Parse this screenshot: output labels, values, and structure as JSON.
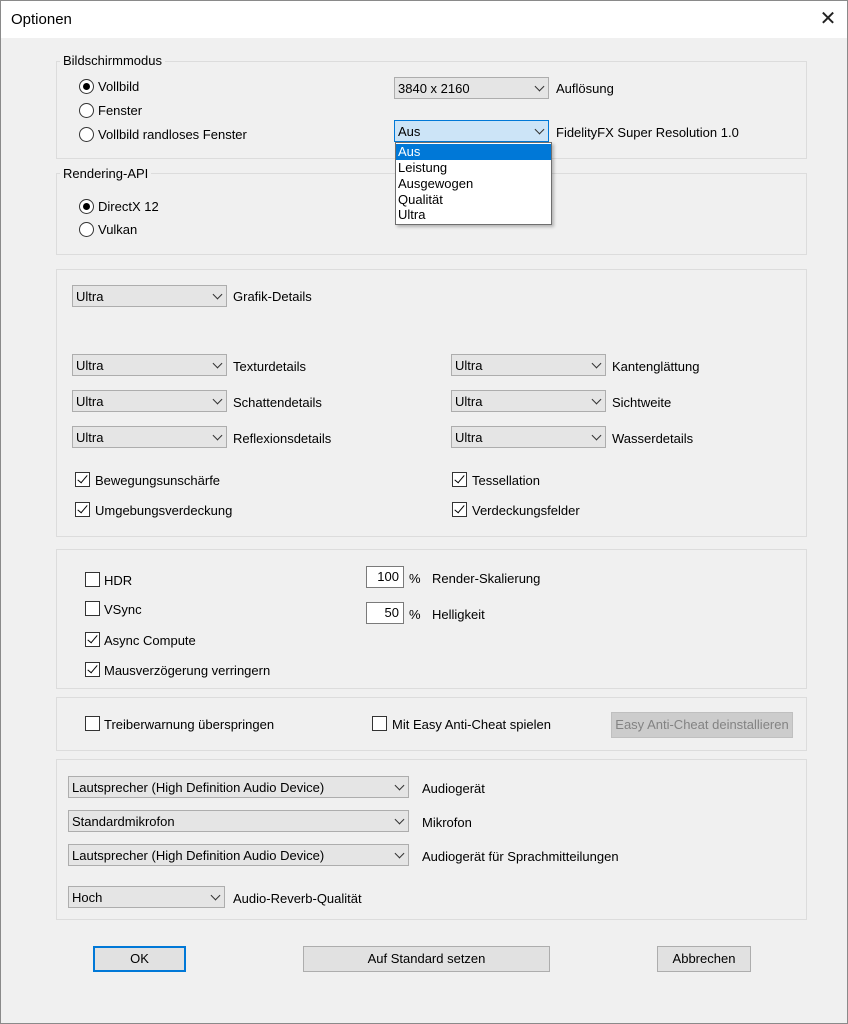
{
  "window": {
    "title": "Optionen",
    "close_glyph": "✕"
  },
  "screen_mode": {
    "group_label": "Bildschirmmodus",
    "options": [
      "Vollbild",
      "Fenster",
      "Vollbild randloses Fenster"
    ],
    "selected": "Vollbild",
    "resolution": {
      "value": "3840 x 2160",
      "label": "Auflösung"
    },
    "fsr": {
      "value": "Aus",
      "label": "FidelityFX Super Resolution 1.0",
      "options": [
        "Aus",
        "Leistung",
        "Ausgewogen",
        "Qualität",
        "Ultra"
      ],
      "highlighted": "Aus"
    }
  },
  "rendering_api": {
    "group_label": "Rendering-API",
    "options": [
      "DirectX 12",
      "Vulkan"
    ],
    "selected": "DirectX 12"
  },
  "graphics": {
    "overall": {
      "value": "Ultra",
      "label": "Grafik-Details"
    },
    "texture": {
      "value": "Ultra",
      "label": "Texturdetails"
    },
    "shadow": {
      "value": "Ultra",
      "label": "Schattendetails"
    },
    "reflection": {
      "value": "Ultra",
      "label": "Reflexionsdetails"
    },
    "antialias": {
      "value": "Ultra",
      "label": "Kantenglättung"
    },
    "view_distance": {
      "value": "Ultra",
      "label": "Sichtweite"
    },
    "water": {
      "value": "Ultra",
      "label": "Wasserdetails"
    },
    "motion_blur": {
      "label": "Bewegungsunschärfe",
      "checked": true
    },
    "ambient_occlusion": {
      "label": "Umgebungsverdeckung",
      "checked": true
    },
    "tessellation": {
      "label": "Tessellation",
      "checked": true
    },
    "occlusion_fields": {
      "label": "Verdeckungsfelder",
      "checked": true
    }
  },
  "display": {
    "hdr": {
      "label": "HDR",
      "checked": false
    },
    "vsync": {
      "label": "VSync",
      "checked": false
    },
    "async_compute": {
      "label": "Async Compute",
      "checked": true
    },
    "mouse_lag": {
      "label": "Mausverzögerung verringern",
      "checked": true
    },
    "render_scale": {
      "value": "100",
      "unit": "%",
      "label": "Render-Skalierung"
    },
    "brightness": {
      "value": "50",
      "unit": "%",
      "label": "Helligkeit"
    }
  },
  "misc": {
    "skip_driver_warning": {
      "label": "Treiberwarnung überspringen",
      "checked": false
    },
    "easy_anticheat": {
      "label": "Mit Easy Anti-Cheat spielen",
      "checked": false
    },
    "uninstall_eac_label": "Easy Anti-Cheat deinstallieren"
  },
  "audio": {
    "device": {
      "value": "Lautsprecher (High Definition Audio Device)",
      "label": "Audiogerät"
    },
    "microphone": {
      "value": "Standardmikrofon",
      "label": "Mikrofon"
    },
    "voice_device": {
      "value": "Lautsprecher (High Definition Audio Device)",
      "label": "Audiogerät für Sprachmitteilungen"
    },
    "reverb": {
      "value": "Hoch",
      "label": "Audio-Reverb-Qualität"
    }
  },
  "buttons": {
    "ok": "OK",
    "defaults": "Auf Standard setzen",
    "cancel": "Abbrechen"
  },
  "colors": {
    "accent": "#0078d7",
    "window_bg": "#f0f0f0",
    "control_bg": "#e5e5e5"
  }
}
